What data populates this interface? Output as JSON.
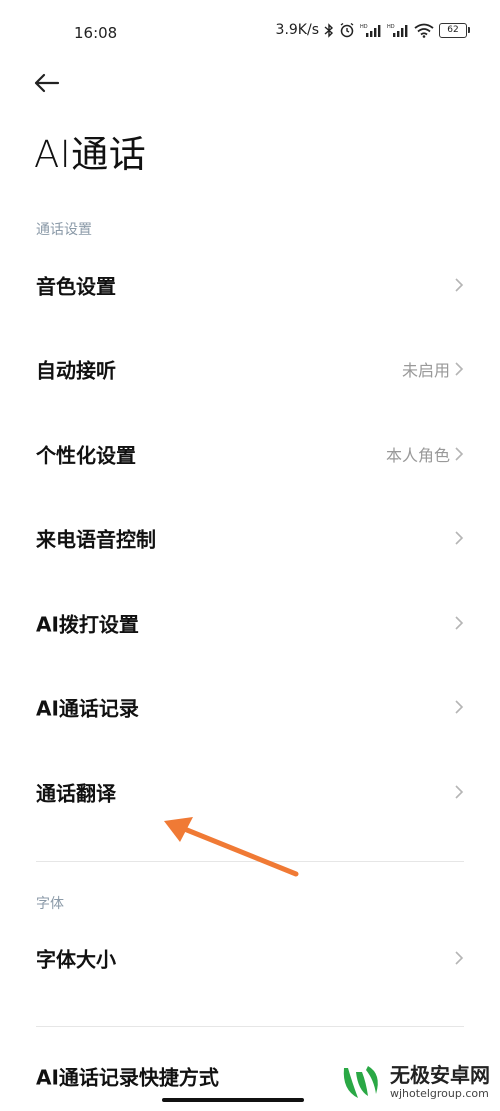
{
  "status_bar": {
    "time": "16:08",
    "net_speed": "3.9K/s",
    "signal_label": "HD",
    "battery": "62"
  },
  "page": {
    "title": "AI通话"
  },
  "sections": {
    "call_settings": {
      "label": "通话设置",
      "items": [
        {
          "label": "音色设置",
          "value": ""
        },
        {
          "label": "自动接听",
          "value": "未启用"
        },
        {
          "label": "个性化设置",
          "value": "本人角色"
        },
        {
          "label": "来电语音控制",
          "value": ""
        },
        {
          "label": "AI拨打设置",
          "value": ""
        },
        {
          "label": "AI通话记录",
          "value": ""
        },
        {
          "label": "通话翻译",
          "value": ""
        }
      ]
    },
    "font": {
      "label": "字体",
      "items": [
        {
          "label": "字体大小",
          "value": ""
        }
      ]
    },
    "shortcut": {
      "items": [
        {
          "label": "AI通话记录快捷方式"
        }
      ]
    }
  },
  "watermark": {
    "title": "无极安卓网",
    "subtitle": "wjhotelgroup.com",
    "logo": "w-leaf-logo"
  },
  "colors": {
    "arrow": "#f07a35",
    "section_label": "#8b9aa8",
    "value_text": "#999999",
    "logo_green": "#2aa845"
  }
}
